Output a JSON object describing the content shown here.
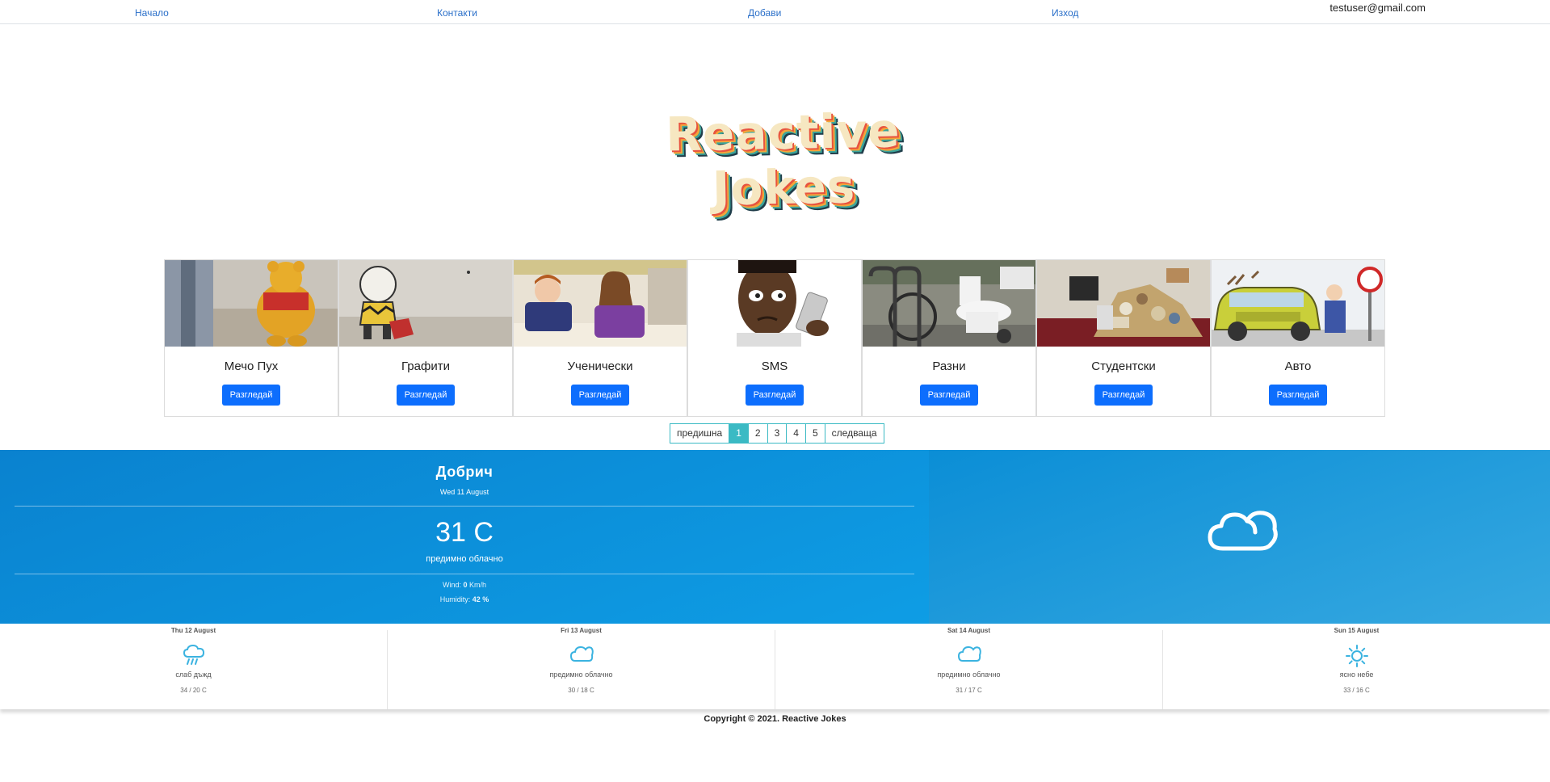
{
  "nav": {
    "items": [
      "Начало",
      "Контакти",
      "Добави",
      "Изход"
    ],
    "user_email": "testuser@gmail.com"
  },
  "logo": {
    "text": "Reactive Jokes"
  },
  "categories": [
    {
      "title": "Мечо Пух",
      "button": "Разгледай",
      "image": "winnie-the-pooh"
    },
    {
      "title": "Графити",
      "button": "Разгледай",
      "image": "charlie-brown-graffiti"
    },
    {
      "title": "Ученически",
      "button": "Разгледай",
      "image": "children-school"
    },
    {
      "title": "SMS",
      "button": "Разгледай",
      "image": "man-with-phone"
    },
    {
      "title": "Разни",
      "button": "Разгледай",
      "image": "bicycle-toilet"
    },
    {
      "title": "Студентски",
      "button": "Разгледай",
      "image": "messy-room"
    },
    {
      "title": "Авто",
      "button": "Разгледай",
      "image": "car-cartoon"
    }
  ],
  "pagination": {
    "prev": "предишна",
    "pages": [
      "1",
      "2",
      "3",
      "4",
      "5"
    ],
    "active": "1",
    "next": "следваща"
  },
  "weather": {
    "city": "Добрич",
    "date": "Wed 11 August",
    "temperature": "31 C",
    "condition": "предимно облачно",
    "wind_label": "Wind:",
    "wind_value": "0",
    "wind_unit": "Km/h",
    "humidity_label": "Humidity:",
    "humidity_value": "42 %",
    "icon": "cloud-icon"
  },
  "forecast": [
    {
      "day": "Thu 12 August",
      "condition": "слаб дъжд",
      "temps": "34 / 20 C",
      "icon": "rain-cloud-icon"
    },
    {
      "day": "Fri 13 August",
      "condition": "предимно облачно",
      "temps": "30 / 18 C",
      "icon": "cloud-icon"
    },
    {
      "day": "Sat 14 August",
      "condition": "предимно облачно",
      "temps": "31 / 17 C",
      "icon": "cloud-icon"
    },
    {
      "day": "Sun 15 August",
      "condition": "ясно небе",
      "temps": "33 / 16 C",
      "icon": "sun-icon"
    }
  ],
  "footer": {
    "copyright": "Copyright © 2021. Reactive Jokes"
  },
  "colors": {
    "link": "#2a6fc9",
    "button": "#0d6efd",
    "pager_accent": "#3bbac4",
    "weather_bg": "#0a82cf",
    "forecast_icon": "#3bb3e0"
  }
}
